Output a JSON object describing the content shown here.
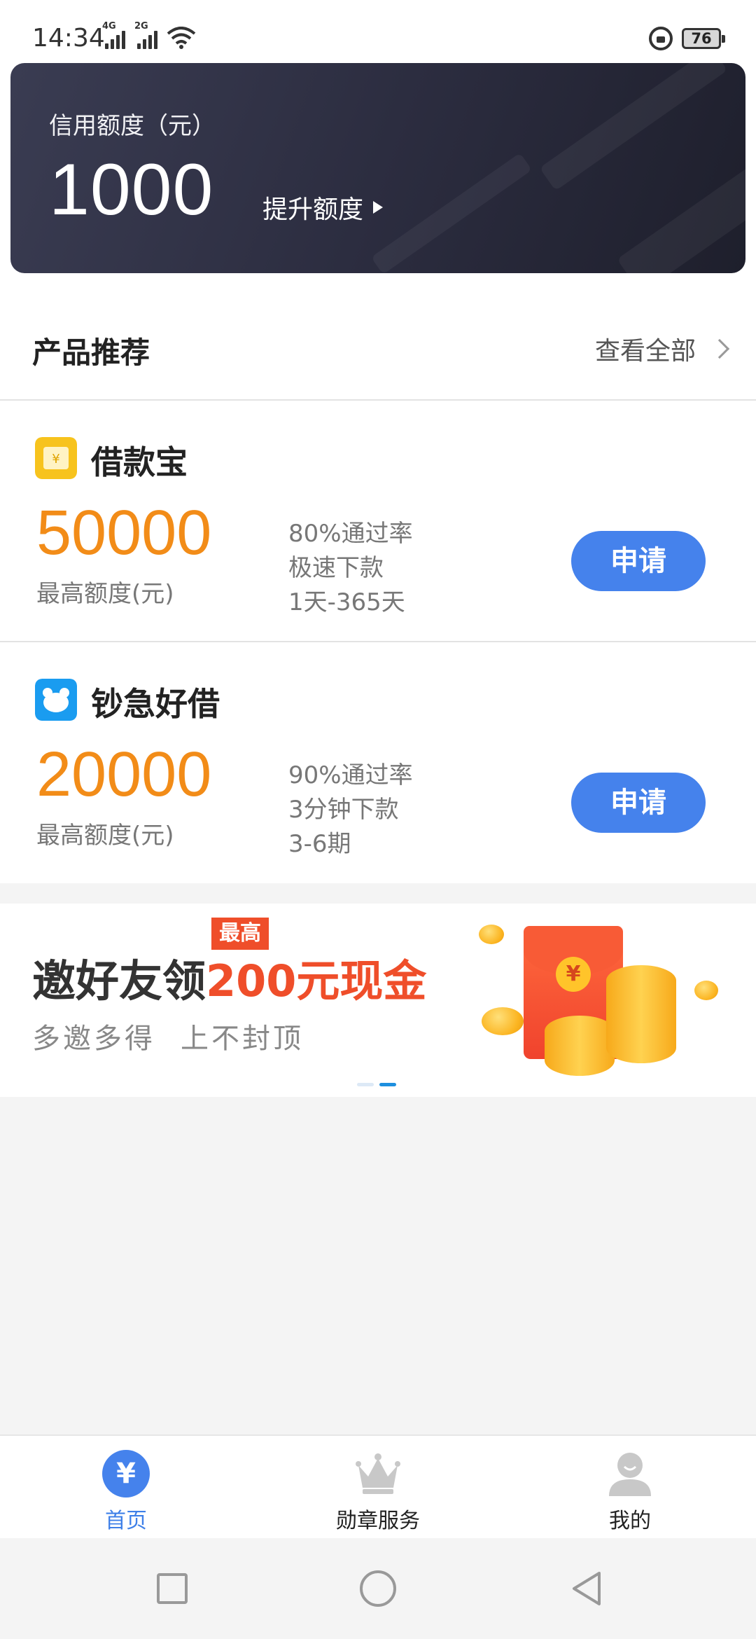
{
  "status_bar": {
    "time": "14:34",
    "signal1_label": "4G",
    "signal2_label": "2G",
    "battery": "76"
  },
  "credit": {
    "label": "信用额度（元）",
    "amount": "1000",
    "raise_label": "提升额度"
  },
  "section": {
    "title": "产品推荐",
    "view_all": "查看全部"
  },
  "products": [
    {
      "name": "借款宝",
      "logo_color": "#f7c31d",
      "limit": "50000",
      "limit_label": "最高额度(元)",
      "features": [
        "80%通过率",
        "极速下款",
        "1天-365天"
      ],
      "button": "申请"
    },
    {
      "name": "钞急好借",
      "logo_color": "#1a9cf0",
      "limit": "20000",
      "limit_label": "最高额度(元)",
      "features": [
        "90%通过率",
        "3分钟下款",
        "3-6期"
      ],
      "button": "申请"
    }
  ],
  "banner": {
    "badge": "最高",
    "title_prefix": "邀好友领",
    "title_highlight": "200元现金",
    "sub1": "多邀多得",
    "sub2": "上不封顶",
    "envelope_symbol": "¥"
  },
  "tabs": [
    {
      "label": "首页",
      "icon": "yen-icon",
      "active": true
    },
    {
      "label": "勋章服务",
      "icon": "crown-icon",
      "active": false
    },
    {
      "label": "我的",
      "icon": "user-icon",
      "active": false
    }
  ],
  "home_icon_symbol": "¥",
  "colors": {
    "accent_blue": "#4582ec",
    "limit_orange": "#f28c18",
    "banner_red": "#ef4e2a",
    "card_dark": "#2c2d40"
  }
}
